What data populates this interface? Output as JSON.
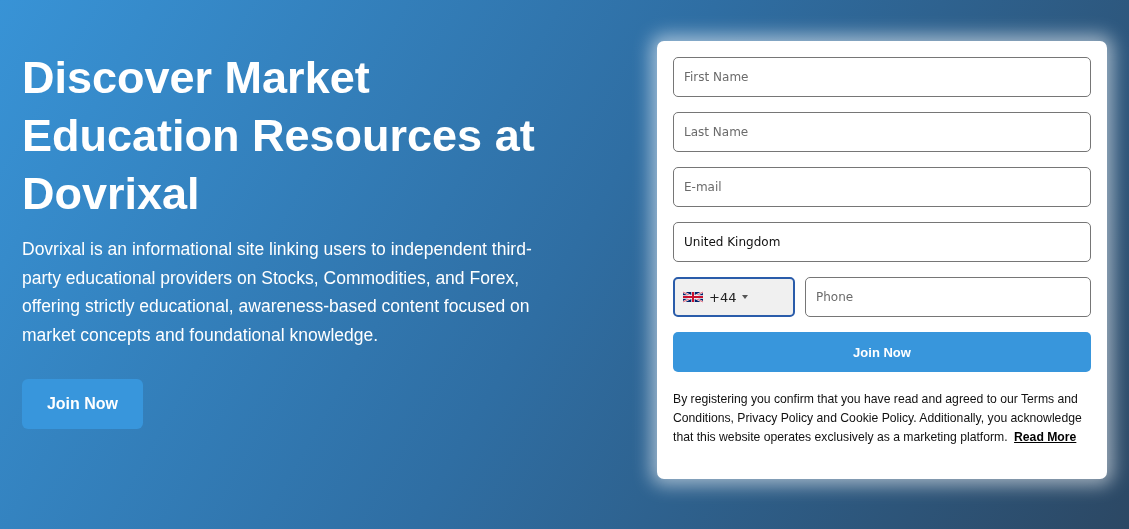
{
  "hero": {
    "heading": "Discover Market Education Resources at Dovrixal",
    "description": "Dovrixal is an informational site linking users to independent third-party educational providers on Stocks, Commodities, and Forex, offering strictly educational, awareness-based content focused on market concepts and foundational knowledge.",
    "button": "Join Now"
  },
  "form": {
    "fields": [
      {
        "placeholder": "First Name"
      },
      {
        "placeholder": "Last Name"
      },
      {
        "placeholder": "E-mail"
      },
      {
        "value": "United Kingdom"
      }
    ],
    "phone": {
      "code": "+44",
      "focused": true,
      "placeholder": "Phone"
    },
    "button": "Join Now",
    "legal": {
      "text": "By registering you confirm that you have read and agreed to our Terms and Conditions, Privacy Policy and Cookie Policy. Additionally, you acknowledge that this website operates exclusively as a marketing platform.",
      "link": "Read More"
    }
  }
}
